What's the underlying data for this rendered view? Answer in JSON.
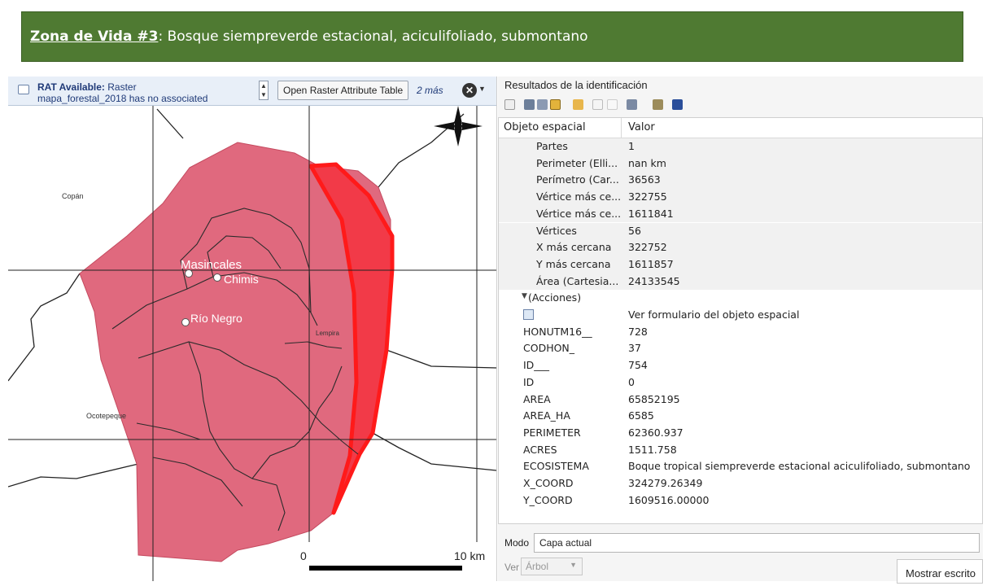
{
  "banner": {
    "zone_label": "Zona de Vida #3",
    "separator": ": ",
    "description": "Bosque siempreverde estacional, aciculifoliado, submontano",
    "bg_color": "#4f7a32"
  },
  "rat_bar": {
    "title_bold": "RAT Available:",
    "title_rest": " Raster",
    "line2": "mapa_forestal_2018 has no associated",
    "open_button": "Open Raster Attribute Table",
    "more_link": "2 más",
    "close_icon": "close-circle-icon",
    "spin_up": "▲",
    "spin_down": "▼",
    "close_glyph": "✕",
    "caret": "▼"
  },
  "map": {
    "labels": {
      "copan": "Copán",
      "ocotepeque": "Ocotepeque",
      "lempira": "Lempira",
      "masincales": "Masincales",
      "chimis": "Chimis",
      "rio_negro": "Río Negro"
    },
    "scale": {
      "start": "0",
      "end": "10 km"
    },
    "north_arrow_icon": "north-arrow-icon",
    "fill_color": "#e0697e",
    "highlight_color": "#ff1a1a"
  },
  "identify": {
    "title": "Resultados de la identificación",
    "col_feature": "Objeto espacial",
    "col_value": "Valor",
    "rows": [
      {
        "key": "Partes",
        "value": "1",
        "indent": 1,
        "alt": true
      },
      {
        "key": "Perimeter (Elli...",
        "value": "nan km",
        "indent": 1,
        "alt": true
      },
      {
        "key": "Perímetro (Car...",
        "value": "36563",
        "indent": 1,
        "alt": true
      },
      {
        "key": "Vértice más ce...",
        "value": "322755",
        "indent": 1,
        "alt": true
      },
      {
        "key": "Vértice más ce...",
        "value": "1611841",
        "indent": 1,
        "alt": true
      },
      {
        "key": "Vértices",
        "value": "56",
        "indent": 1,
        "alt": true
      },
      {
        "key": "X más cercana",
        "value": "322752",
        "indent": 1,
        "alt": true
      },
      {
        "key": "Y más cercana",
        "value": "1611857",
        "indent": 1,
        "alt": true
      },
      {
        "key": "Área (Cartesia...",
        "value": "24133545",
        "indent": 1,
        "alt": true
      },
      {
        "key": "(Acciones)",
        "value": "",
        "indent": 0,
        "alt": false,
        "expander": "▼"
      },
      {
        "key": "",
        "value": "Ver formulario del objeto espacial",
        "indent": 1,
        "alt": false,
        "form_icon": true
      },
      {
        "key": "HONUTM16__",
        "value": "728",
        "indent": 0,
        "alt": false
      },
      {
        "key": "CODHON_",
        "value": "37",
        "indent": 0,
        "alt": false
      },
      {
        "key": "ID___",
        "value": "754",
        "indent": 0,
        "alt": false
      },
      {
        "key": "ID",
        "value": "0",
        "indent": 0,
        "alt": false
      },
      {
        "key": "AREA",
        "value": "65852195",
        "indent": 0,
        "alt": false
      },
      {
        "key": "AREA_HA",
        "value": "6585",
        "indent": 0,
        "alt": false
      },
      {
        "key": "PERIMETER",
        "value": "62360.937",
        "indent": 0,
        "alt": false
      },
      {
        "key": "ACRES",
        "value": "1511.758",
        "indent": 0,
        "alt": false
      },
      {
        "key": "ECOSISTEMA",
        "value": "Boque tropical siempreverde estacional aciculifoliado, submontano",
        "indent": 0,
        "alt": false
      },
      {
        "key": "X_COORD",
        "value": "324279.26349",
        "indent": 0,
        "alt": false
      },
      {
        "key": "Y_COORD",
        "value": "1609516.00000",
        "indent": 0,
        "alt": false
      }
    ],
    "mode_label": "Modo",
    "mode_value": "Capa actual",
    "view_label": "Ver",
    "view_value": "Árbol",
    "view_caret": "▼",
    "show_button": "Mostrar escrito"
  }
}
